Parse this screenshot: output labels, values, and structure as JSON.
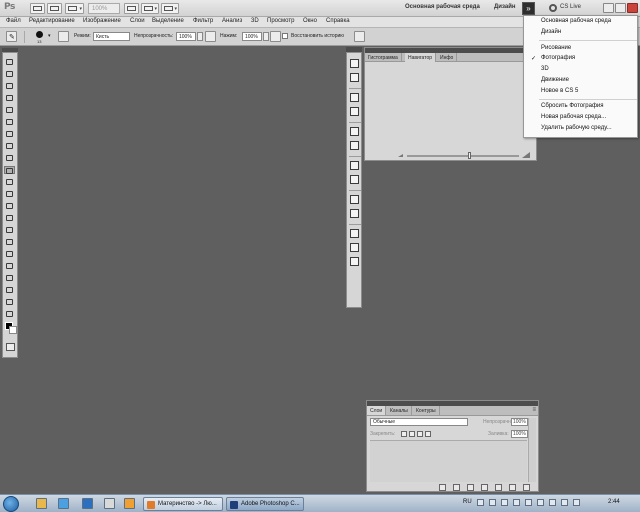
{
  "app": {
    "logo": "Ps",
    "zoom": "100%",
    "workspace_active": "Основная рабочая среда",
    "workspace_design": "Дизайн",
    "more_workspaces": "»",
    "cslive": "CS Live"
  },
  "menu": [
    "Файл",
    "Редактирование",
    "Изображение",
    "Слои",
    "Выделение",
    "Фильтр",
    "Анализ",
    "3D",
    "Просмотр",
    "Окно",
    "Справка"
  ],
  "options": {
    "brush_size": "13",
    "mode_label": "Режим:",
    "mode_value": "Кисть",
    "opacity_label": "Непрозрачность:",
    "opacity_value": "100%",
    "flow_label": "Нажим:",
    "flow_value": "100%",
    "history_label": "Восстановить историю"
  },
  "navigator": {
    "tabs": [
      "Гистограмма",
      "Навигатор",
      "Инфо"
    ],
    "active_tab": 1,
    "menu_icon": "≡"
  },
  "workspace_menu": {
    "items": [
      "Основная рабочая среда",
      "Дизайн",
      "Рисование",
      "Фотография",
      "3D",
      "Движение",
      "Новое в CS 5",
      "Сбросить Фотография",
      "Новая рабочая среда...",
      "Удалить рабочую среду..."
    ],
    "checked_index": 3,
    "check_mark": "✓"
  },
  "layers": {
    "tabs": [
      "Слои",
      "Каналы",
      "Контуры"
    ],
    "active_tab": 0,
    "blend_mode": "Обычные",
    "opacity_label": "Непрозрачность:",
    "opacity_value": "100%",
    "lock_label": "Закрепить:",
    "fill_label": "Заливка:",
    "fill_value": "100%"
  },
  "taskbar": {
    "tasks": [
      "Материнство -> Лю...",
      "Adobe Photoshop C..."
    ],
    "active_task": 1,
    "language": "RU",
    "clock": "2:44"
  },
  "colors": {
    "canvas": "#5f5f5f",
    "panel": "#d7d7d7",
    "panel_head": "#4c4c4c",
    "foreground": "#000000",
    "background": "#ffffff"
  }
}
